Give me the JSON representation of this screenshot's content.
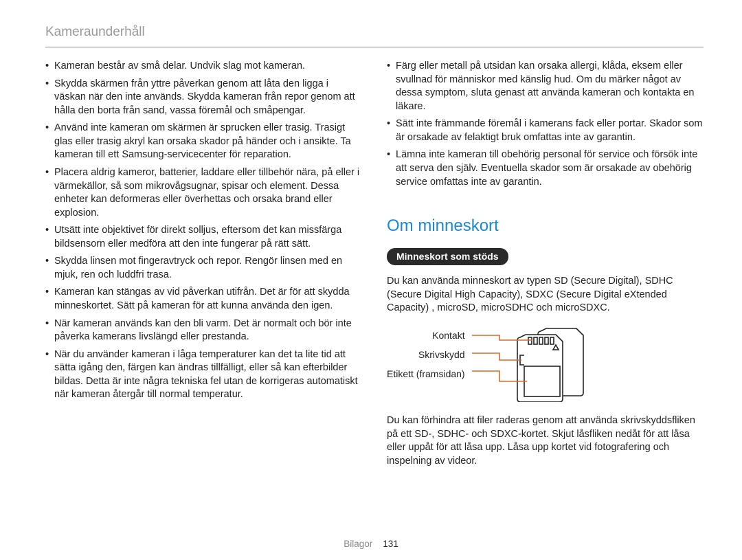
{
  "header": "Kameraunderhåll",
  "left_bullets": [
    "Kameran består av små delar. Undvik slag mot kameran.",
    "Skydda skärmen från yttre påverkan genom att låta den ligga i väskan när den inte används. Skydda kameran från repor genom att hålla den borta från sand, vassa föremål och småpengar.",
    "Använd inte kameran om skärmen är sprucken eller trasig. Trasigt glas eller trasig akryl kan orsaka skador på händer och i ansikte. Ta kameran till ett Samsung-servicecenter för reparation.",
    "Placera aldrig kameror, batterier, laddare eller tillbehör nära, på eller i värmekällor, så som mikrovågsugnar, spisar och element. Dessa enheter kan deformeras eller överhettas och orsaka brand eller explosion.",
    "Utsätt inte objektivet för direkt solljus, eftersom det kan missfärga bildsensorn eller medföra att den inte fungerar på rätt sätt.",
    "Skydda linsen mot fingeravtryck och repor. Rengör linsen med en mjuk, ren och luddfri trasa.",
    "Kameran kan stängas av vid påverkan utifrån. Det är för att skydda minneskortet. Sätt på kameran för att kunna använda den igen.",
    "När kameran används kan den bli varm. Det är normalt och bör inte påverka kamerans livslängd eller prestanda.",
    "När du använder kameran i låga temperaturer kan det ta lite tid att sätta igång den, färgen kan ändras tillfälligt, eller så kan efterbilder bildas. Detta är inte några tekniska fel utan de korrigeras automatiskt när kameran återgår till normal temperatur."
  ],
  "right_bullets": [
    "Färg eller metall på utsidan kan orsaka allergi, klåda, eksem eller svullnad för människor med känslig hud. Om du märker något av dessa symptom, sluta genast att använda kameran och kontakta en läkare.",
    "Sätt inte främmande föremål i kamerans fack eller portar. Skador som är orsakade av felaktigt bruk omfattas inte av garantin.",
    "Lämna inte kameran till obehörig personal för service och försök inte att serva den själv. Eventuella skador som är orsakade av obehörig service omfattas inte av garantin."
  ],
  "memory": {
    "section_title": "Om minneskort",
    "pill": "Minneskort som stöds",
    "intro": "Du kan använda minneskort av typen SD (Secure Digital), SDHC (Secure Digital High Capacity), SDXC (Secure Digital eXtended Capacity) , microSD, microSDHC och microSDXC.",
    "labels": {
      "contact": "Kontakt",
      "write_protect": "Skrivskydd",
      "label_front": "Etikett (framsidan)"
    },
    "outro": "Du kan förhindra att filer raderas genom att använda skrivskyddsfliken på ett SD-, SDHC- och SDXC-kortet. Skjut låsfliken nedåt för att låsa eller uppåt för att låsa upp. Låsa upp kortet vid fotografering och inspelning av videor."
  },
  "footer": {
    "section": "Bilagor",
    "page": "131"
  }
}
